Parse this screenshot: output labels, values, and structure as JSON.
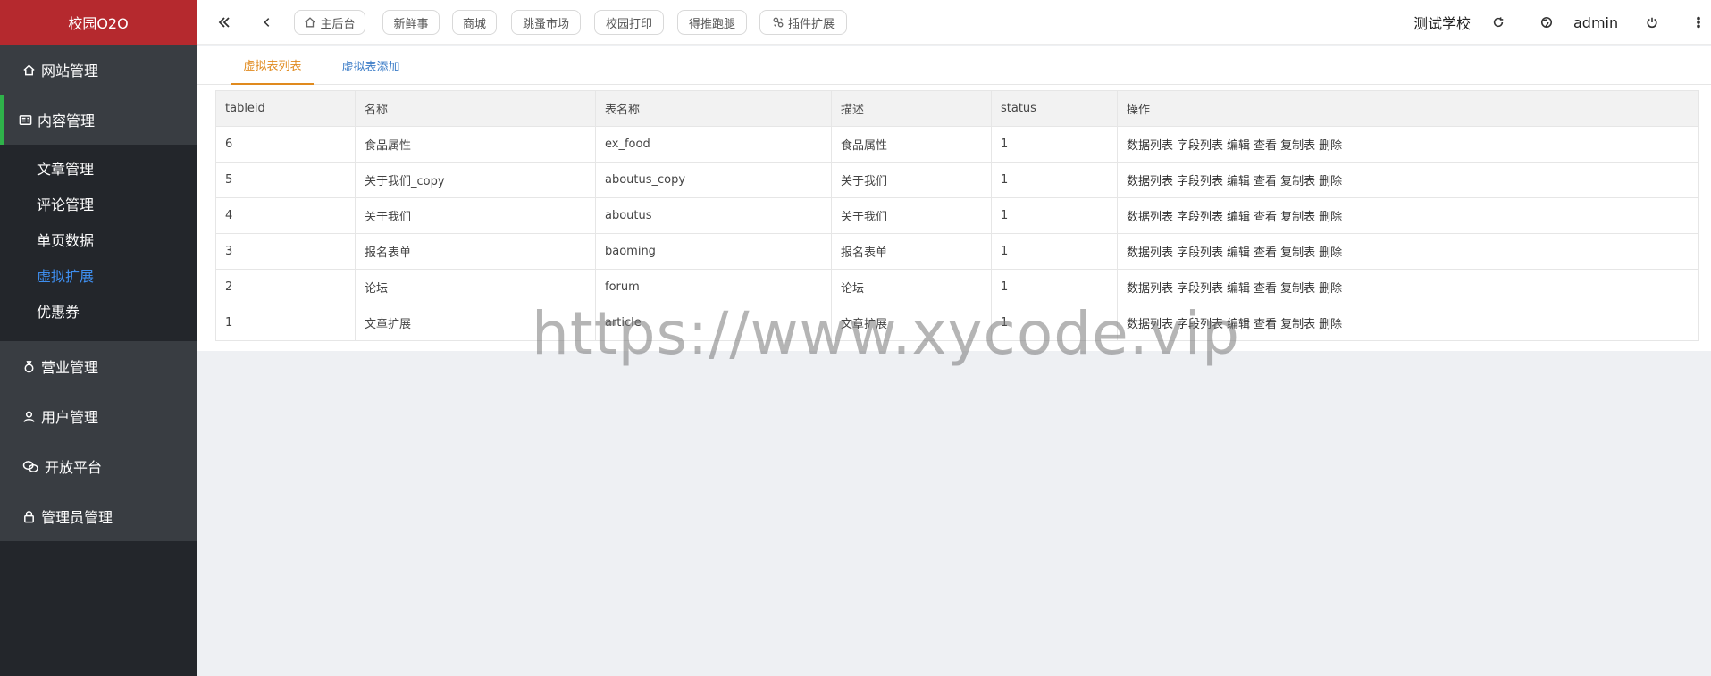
{
  "sidebar": {
    "brand": "校园O2O",
    "items": [
      {
        "label": "网站管理",
        "icon": "home-icon"
      },
      {
        "label": "内容管理",
        "icon": "content-icon",
        "active": true
      },
      {
        "label": "营业管理",
        "icon": "money-bag-icon"
      },
      {
        "label": "用户管理",
        "icon": "user-icon"
      },
      {
        "label": "开放平台",
        "icon": "wechat-icon"
      },
      {
        "label": "管理员管理",
        "icon": "lock-icon"
      }
    ],
    "subitems": [
      {
        "label": "文章管理"
      },
      {
        "label": "评论管理"
      },
      {
        "label": "单页数据"
      },
      {
        "label": "虚拟扩展",
        "current": true
      },
      {
        "label": "优惠券"
      }
    ],
    "active_color": "#2fb24a",
    "current_sub_color": "#3e8eef",
    "brand_color": "#b5292e"
  },
  "topbar": {
    "pills": [
      "主后台",
      "新鲜事",
      "商城",
      "跳蚤市场",
      "校园打印",
      "得推跑腿",
      "插件扩展"
    ],
    "school": "测试学校",
    "user": "admin"
  },
  "tabs": {
    "active": "虚拟表列表",
    "inactive": "虚拟表添加",
    "active_color": "#e08a1e"
  },
  "table": {
    "headers": [
      "tableid",
      "名称",
      "表名称",
      "描述",
      "status",
      "操作"
    ],
    "rows": [
      [
        "6",
        "食品属性",
        "ex_food",
        "食品属性",
        "1"
      ],
      [
        "5",
        "关于我们_copy",
        "aboutus_copy",
        "关于我们",
        "1"
      ],
      [
        "4",
        "关于我们",
        "aboutus",
        "关于我们",
        "1"
      ],
      [
        "3",
        "报名表单",
        "baoming",
        "报名表单",
        "1"
      ],
      [
        "2",
        "论坛",
        "forum",
        "论坛",
        "1"
      ],
      [
        "1",
        "文章扩展",
        "article",
        "文章扩展",
        "1"
      ]
    ],
    "actions": [
      "数据列表",
      "字段列表",
      "编辑",
      "查看",
      "复制表",
      "删除"
    ]
  },
  "watermark": "https://www.xycode.vip"
}
